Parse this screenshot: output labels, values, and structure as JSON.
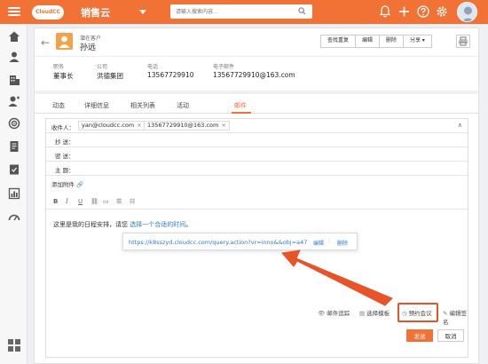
{
  "topbar": {
    "logo_text": "CloudCC",
    "app_name": "销售云",
    "search_placeholder": "请输入搜索内容...",
    "brand_color": "#f27135"
  },
  "record": {
    "type_label": "潜在客户",
    "name": "孙远",
    "buttons": [
      "查找重复",
      "编辑",
      "删除",
      "分享"
    ],
    "fields": [
      {
        "label": "职务",
        "value": "董事长"
      },
      {
        "label": "公司",
        "value": "洪德集团"
      },
      {
        "label": "电话",
        "value": "13567729910"
      },
      {
        "label": "电子邮件",
        "value": "13567729910@163.com"
      }
    ]
  },
  "tabs": [
    {
      "label": "动态"
    },
    {
      "label": "详细信息"
    },
    {
      "label": "相关列表"
    },
    {
      "label": "活动"
    },
    {
      "label": "邮件",
      "active": true
    }
  ],
  "email": {
    "to_label": "收件人：",
    "recipients": [
      "yan@cloudcc.com",
      "13567729910@163.com"
    ],
    "cc_label": "抄  送：",
    "bcc_label": "密  送：",
    "subject_label": "主  题：",
    "attach_label": "添加附件",
    "body_prefix": "这里是我的日程安排，请您 ",
    "body_link": "选择一个合适的时间",
    "body_suffix": "。",
    "popup": {
      "url": "https://k8sszyd.cloudcc.com/query.action?vr=inno&&obj=a47",
      "edit": "编辑",
      "delete": "删除"
    },
    "bottom_tools": {
      "track": "邮件追踪",
      "template": "选择模板",
      "meeting": "预约会议",
      "signature": "编辑签名"
    },
    "send": "发送",
    "cancel": "取消"
  },
  "annotation_color": "#e8532a"
}
